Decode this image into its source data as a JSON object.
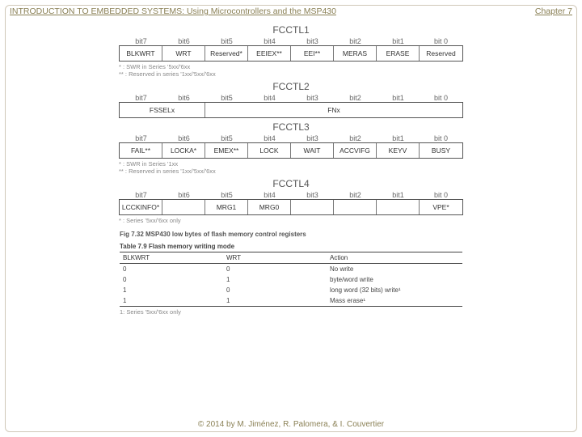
{
  "header": {
    "title": "INTRODUCTION TO EMBEDDED SYSTEMS: Using Microcontrollers and the MSP430",
    "chapter": "Chapter 7"
  },
  "registers": [
    {
      "name": "FCCTL1",
      "bits": [
        "bit7",
        "bit6",
        "bit5",
        "bit4",
        "bit3",
        "bit2",
        "bit1",
        "bit 0"
      ],
      "cells": [
        {
          "label": "BLKWRT",
          "span": 1
        },
        {
          "label": "WRT",
          "span": 1
        },
        {
          "label": "Reserved*",
          "span": 1
        },
        {
          "label": "EEIEX**",
          "span": 1
        },
        {
          "label": "EEI**",
          "span": 1
        },
        {
          "label": "MERAS",
          "span": 1
        },
        {
          "label": "ERASE",
          "span": 1
        },
        {
          "label": "Reserved",
          "span": 1
        }
      ],
      "notes": [
        "* : SWR in Series '5xx/'6xx",
        "** : Reserved in series '1xx/'5xx/'6xx"
      ]
    },
    {
      "name": "FCCTL2",
      "bits": [
        "bit7",
        "bit6",
        "bit5",
        "bit4",
        "bit3",
        "bit2",
        "bit1",
        "bit 0"
      ],
      "cells": [
        {
          "label": "FSSELx",
          "span": 2
        },
        {
          "label": "FNx",
          "span": 6
        }
      ],
      "notes": []
    },
    {
      "name": "FCCTL3",
      "bits": [
        "bit7",
        "bit6",
        "bit5",
        "bit4",
        "bit3",
        "bit2",
        "bit1",
        "bit 0"
      ],
      "cells": [
        {
          "label": "FAIL**",
          "span": 1
        },
        {
          "label": "LOCKA*",
          "span": 1
        },
        {
          "label": "EMEX**",
          "span": 1
        },
        {
          "label": "LOCK",
          "span": 1
        },
        {
          "label": "WAIT",
          "span": 1
        },
        {
          "label": "ACCVIFG",
          "span": 1
        },
        {
          "label": "KEYV",
          "span": 1
        },
        {
          "label": "BUSY",
          "span": 1
        }
      ],
      "notes": [
        "* : SWR in Series '1xx",
        "** : Reserved in series '1xx/'5xx/'6xx"
      ]
    },
    {
      "name": "FCCTL4",
      "bits": [
        "bit7",
        "bit6",
        "bit5",
        "bit4",
        "bit3",
        "bit2",
        "bit1",
        "bit 0"
      ],
      "cells": [
        {
          "label": "LCCKINFO*",
          "span": 1
        },
        {
          "label": "",
          "span": 1
        },
        {
          "label": "MRG1",
          "span": 1
        },
        {
          "label": "MRG0",
          "span": 1
        },
        {
          "label": "",
          "span": 1
        },
        {
          "label": "",
          "span": 1
        },
        {
          "label": "",
          "span": 1
        },
        {
          "label": "VPE*",
          "span": 1
        }
      ],
      "notes": [
        "* : Series '5xx/'6xx only"
      ]
    }
  ],
  "figcaption": "Fig 7.32 MSP430 low bytes of flash memory control registers",
  "tablecaption": "Table 7.9  Flash memory writing mode",
  "wtable": {
    "headers": [
      "BLKWRT",
      "WRT",
      "Action"
    ],
    "rows": [
      [
        "0",
        "0",
        "No write"
      ],
      [
        "0",
        "1",
        "byte/word write"
      ],
      [
        "1",
        "0",
        "long word (32 bits) write¹"
      ],
      [
        "1",
        "1",
        "Mass erase¹"
      ]
    ],
    "note": "1: Series '5xx/'6xx only"
  },
  "footer": "© 2014 by M. Jiménez, R. Palomera, & I. Couvertier"
}
